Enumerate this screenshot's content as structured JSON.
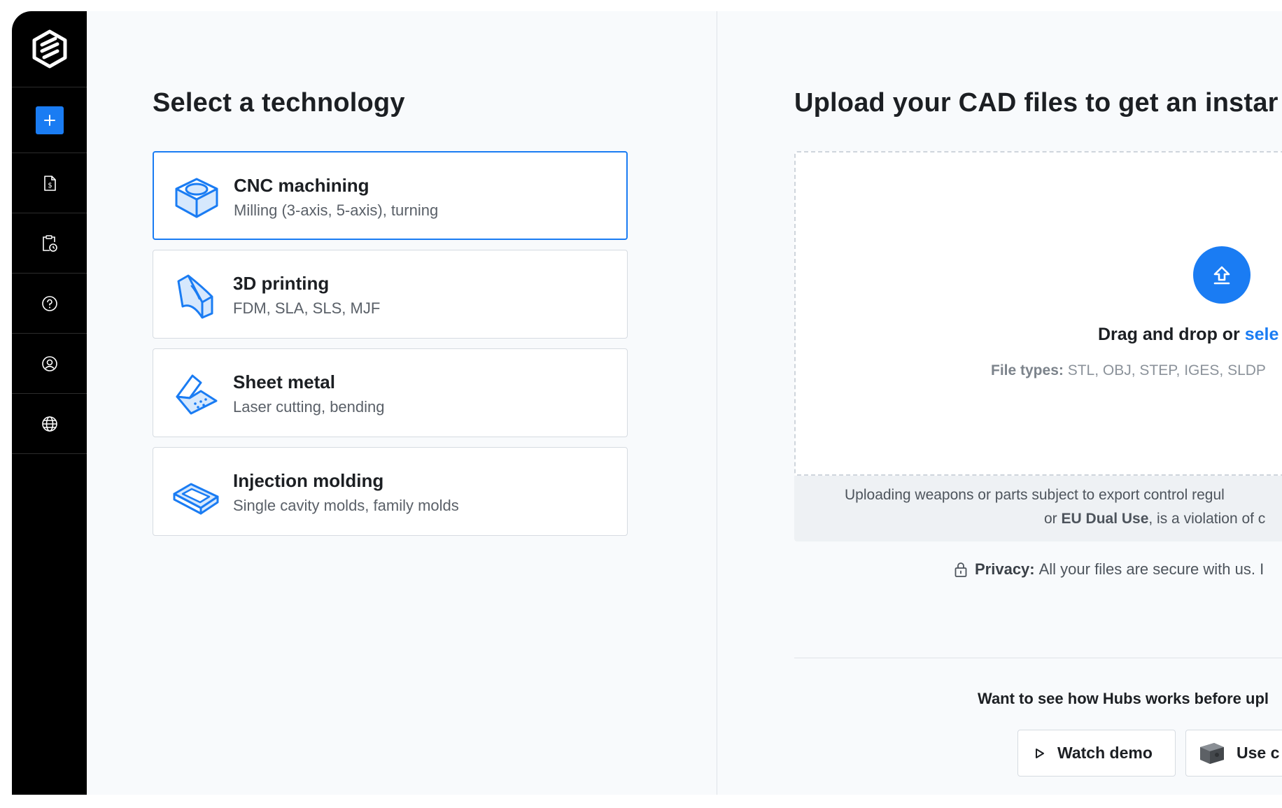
{
  "sidebar": {
    "items": [
      {
        "name": "logo",
        "icon": "hubs-logo-icon"
      },
      {
        "name": "new-quote",
        "icon": "plus-icon"
      },
      {
        "name": "quotes",
        "icon": "document-dollar-icon"
      },
      {
        "name": "orders",
        "icon": "clipboard-clock-icon"
      },
      {
        "name": "help",
        "icon": "question-circle-icon"
      },
      {
        "name": "account",
        "icon": "user-circle-icon"
      },
      {
        "name": "language",
        "icon": "globe-icon"
      }
    ]
  },
  "left": {
    "title": "Select a technology",
    "technologies": [
      {
        "name": "CNC machining",
        "desc": "Milling (3-axis, 5-axis), turning",
        "selected": true
      },
      {
        "name": "3D printing",
        "desc": "FDM, SLA, SLS, MJF",
        "selected": false
      },
      {
        "name": "Sheet metal",
        "desc": "Laser cutting, bending",
        "selected": false
      },
      {
        "name": "Injection molding",
        "desc": "Single cavity molds, family molds",
        "selected": false
      }
    ]
  },
  "right": {
    "title": "Upload your CAD files to get an instar",
    "drop": {
      "prefix": "Drag and drop or ",
      "link": "sele",
      "filetypes_label": "File types:",
      "filetypes_value": " STL, OBJ, STEP, IGES, SLDP"
    },
    "warning": {
      "line1": "Uploading weapons or parts subject to export control regul",
      "line2_prefix": "or ",
      "line2_bold": "EU Dual Use",
      "line2_suffix": ", is a violation of c"
    },
    "privacy": {
      "label": "Privacy:",
      "text": "All your files are secure with us. I"
    },
    "demo": {
      "question": "Want to see how Hubs works before upl",
      "watch_label": "Watch demo",
      "example_label": "Use c"
    }
  },
  "colors": {
    "accent": "#1a7cf3",
    "sidebar": "#000000",
    "background": "#f8fafc"
  }
}
